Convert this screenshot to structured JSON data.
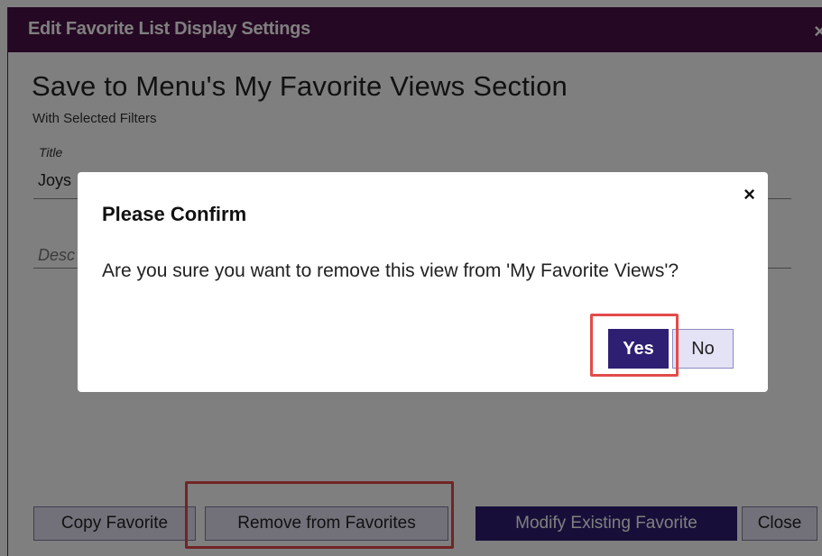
{
  "window": {
    "title": "Edit Favorite List Display Settings",
    "close_glyph": "×"
  },
  "form": {
    "heading": "Save to Menu's My Favorite Views Section",
    "subheading": "With Selected Filters",
    "title_label": "Title",
    "title_value": "Joys",
    "description_placeholder": "Desc"
  },
  "footer": {
    "copy_label": "Copy Favorite",
    "remove_label": "Remove from Favorites",
    "modify_label": "Modify Existing Favorite",
    "close_label": "Close"
  },
  "dialog": {
    "title": "Please Confirm",
    "message": "Are you sure you want to remove this view from 'My Favorite Views'?",
    "yes_label": "Yes",
    "no_label": "No",
    "close_glyph": "×"
  },
  "colors": {
    "titlebar": "#4a1147",
    "primary_button": "#2f1f73",
    "secondary_button": "#e4e2f5",
    "highlight": "#e34b4b"
  }
}
